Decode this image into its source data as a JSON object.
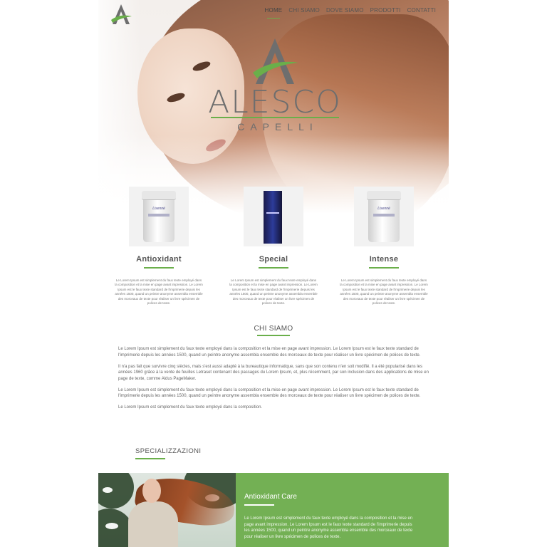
{
  "nav": {
    "items": [
      {
        "label": "HOME",
        "active": true
      },
      {
        "label": "CHI SIAMO",
        "active": false
      },
      {
        "label": "DOVE SIAMO",
        "active": false
      },
      {
        "label": "PRODOTTI",
        "active": false
      },
      {
        "label": "CONTATTI",
        "active": false
      }
    ]
  },
  "brand": {
    "name": "ALESCO",
    "subtitle": "CAPELLI",
    "accent_color": "#6aaf4a"
  },
  "products": [
    {
      "title": "Antioxidant",
      "image": "product-jar",
      "jar_label": "Lisenné",
      "text": "Le Lorem Ipsum est simplement du faux texte employé dans la composition et la mise en page avant impression. Le Lorem Ipsum est le faux texte standard de l'imprimerie depuis les années 1500, quand un peintre anonyme assembla ensemble des morceaux de texte pour réaliser un livre spécimen de polices de texte."
    },
    {
      "title": "Special",
      "image": "product-bottle",
      "text": "Le Lorem Ipsum est simplement du faux texte employé dans la composition et la mise en page avant impression. Le Lorem Ipsum est le faux texte standard de l'imprimerie depuis les années 1500, quand un peintre anonyme assembla ensemble des morceaux de texte pour réaliser un livre spécimen de polices de texte."
    },
    {
      "title": "Intense",
      "image": "product-jar",
      "jar_label": "Lisenné",
      "text": "Le Lorem Ipsum est simplement du faux texte employé dans la composition et la mise en page avant impression. Le Lorem Ipsum est le faux texte standard de l'imprimerie depuis les années 1500, quand un peintre anonyme assembla ensemble des morceaux de texte pour réaliser un livre spécimen de polices de texte."
    }
  ],
  "about": {
    "title": "CHI SIAMO",
    "paragraphs": [
      "Le Lorem Ipsum est simplement du faux texte employé dans la composition et la mise en page avant impression. Le Lorem Ipsum est le faux texte standard de l'imprimerie depuis les années 1500, quand un peintre anonyme assembla ensemble des morceaux de texte pour réaliser un livre spécimen de polices de texte.",
      "Il n'a pas fait que survivre cinq siècles, mais s'est aussi adapté à la bureautique informatique, sans que son contenu n'en soit modifié. Il a été popularisé dans les années 1960 grâce à la vente de feuilles Letraset contenant des passages du Lorem Ipsum, et, plus récemment, par son inclusion dans des applications de mise en page de texte, comme Aldus PageMaker.",
      "Le Lorem Ipsum est simplement du faux texte employé dans la composition et la mise en page avant impression. Le Lorem Ipsum est le faux texte standard de l'imprimerie depuis les années 1500, quand un peintre anonyme assembla ensemble des morceaux de texte pour réaliser un livre spécimen de polices de texte.",
      "Le Lorem Ipsum est simplement du faux texte employé dans la composition."
    ]
  },
  "specializations": {
    "title": "SPECIALIZZAZIONI",
    "card": {
      "title": "Antioxidant Care",
      "text": "Le Lorem Ipsum est simplement du faux texte employé dans la composition et la mise en page avant impression. Le Lorem Ipsum est le faux texte standard de l'imprimerie depuis les années 1500, quand un peintre anonyme assembla ensemble des morceaux de texte pour réaliser un livre spécimen de polices de texte.",
      "panel_color": "#73b054"
    }
  }
}
